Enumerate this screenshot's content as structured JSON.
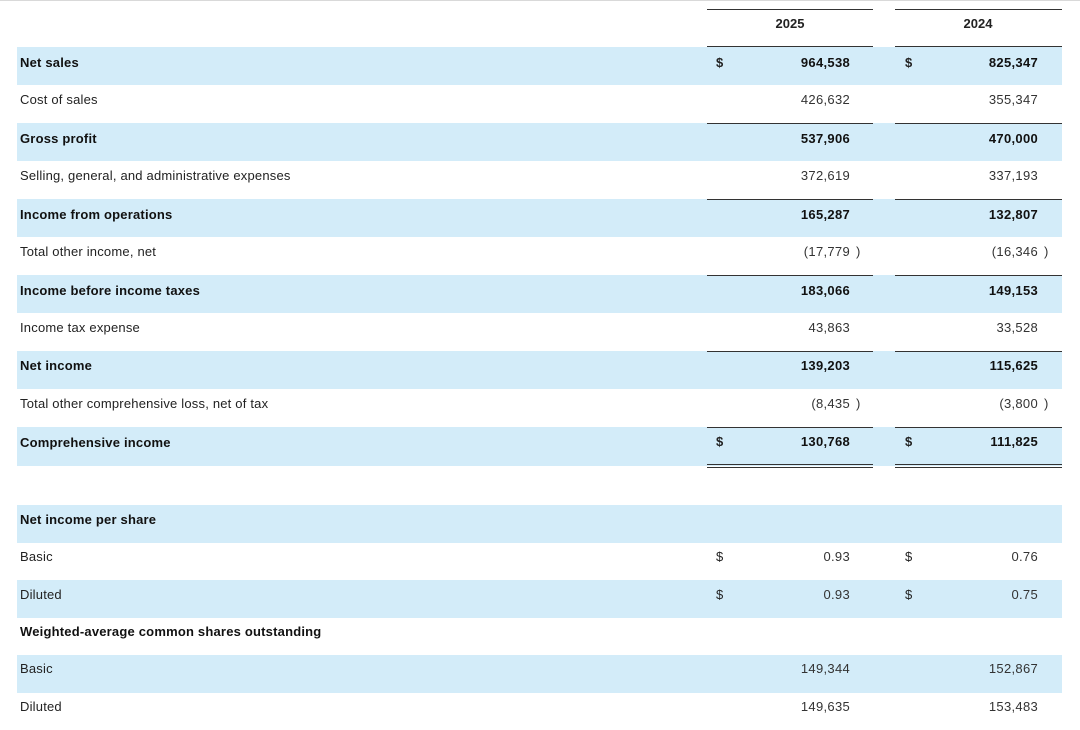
{
  "columns": {
    "year1": "2025",
    "year2": "2024"
  },
  "currency_symbol": "$",
  "rows": [
    {
      "label": "Net sales",
      "v1": "964,538",
      "v2": "825,347"
    },
    {
      "label": "Cost of sales",
      "v1": "426,632",
      "v2": "355,347"
    },
    {
      "label": "Gross profit",
      "v1": "537,906",
      "v2": "470,000"
    },
    {
      "label": "Selling, general, and administrative expenses",
      "v1": "372,619",
      "v2": "337,193"
    },
    {
      "label": "Income from operations",
      "v1": "165,287",
      "v2": "132,807"
    },
    {
      "label": "Total other income, net",
      "v1": "(17,779",
      "v2": "(16,346"
    },
    {
      "label": "Income before income taxes",
      "v1": "183,066",
      "v2": "149,153"
    },
    {
      "label": "Income tax expense",
      "v1": "43,863",
      "v2": "33,528"
    },
    {
      "label": "Net income",
      "v1": "139,203",
      "v2": "115,625"
    },
    {
      "label": "Total other comprehensive loss, net of tax",
      "v1": "(8,435",
      "v2": "(3,800"
    },
    {
      "label": "Comprehensive income",
      "v1": "130,768",
      "v2": "111,825"
    },
    {
      "label": "Net income per share"
    },
    {
      "label": "Basic",
      "v1": "0.93",
      "v2": "0.76"
    },
    {
      "label": "Diluted",
      "v1": "0.93",
      "v2": "0.75"
    },
    {
      "label": "Weighted-average common shares outstanding"
    },
    {
      "label": "Basic",
      "v1": "149,344",
      "v2": "152,867"
    },
    {
      "label": "Diluted",
      "v1": "149,635",
      "v2": "153,483"
    }
  ],
  "paren_close": ")"
}
